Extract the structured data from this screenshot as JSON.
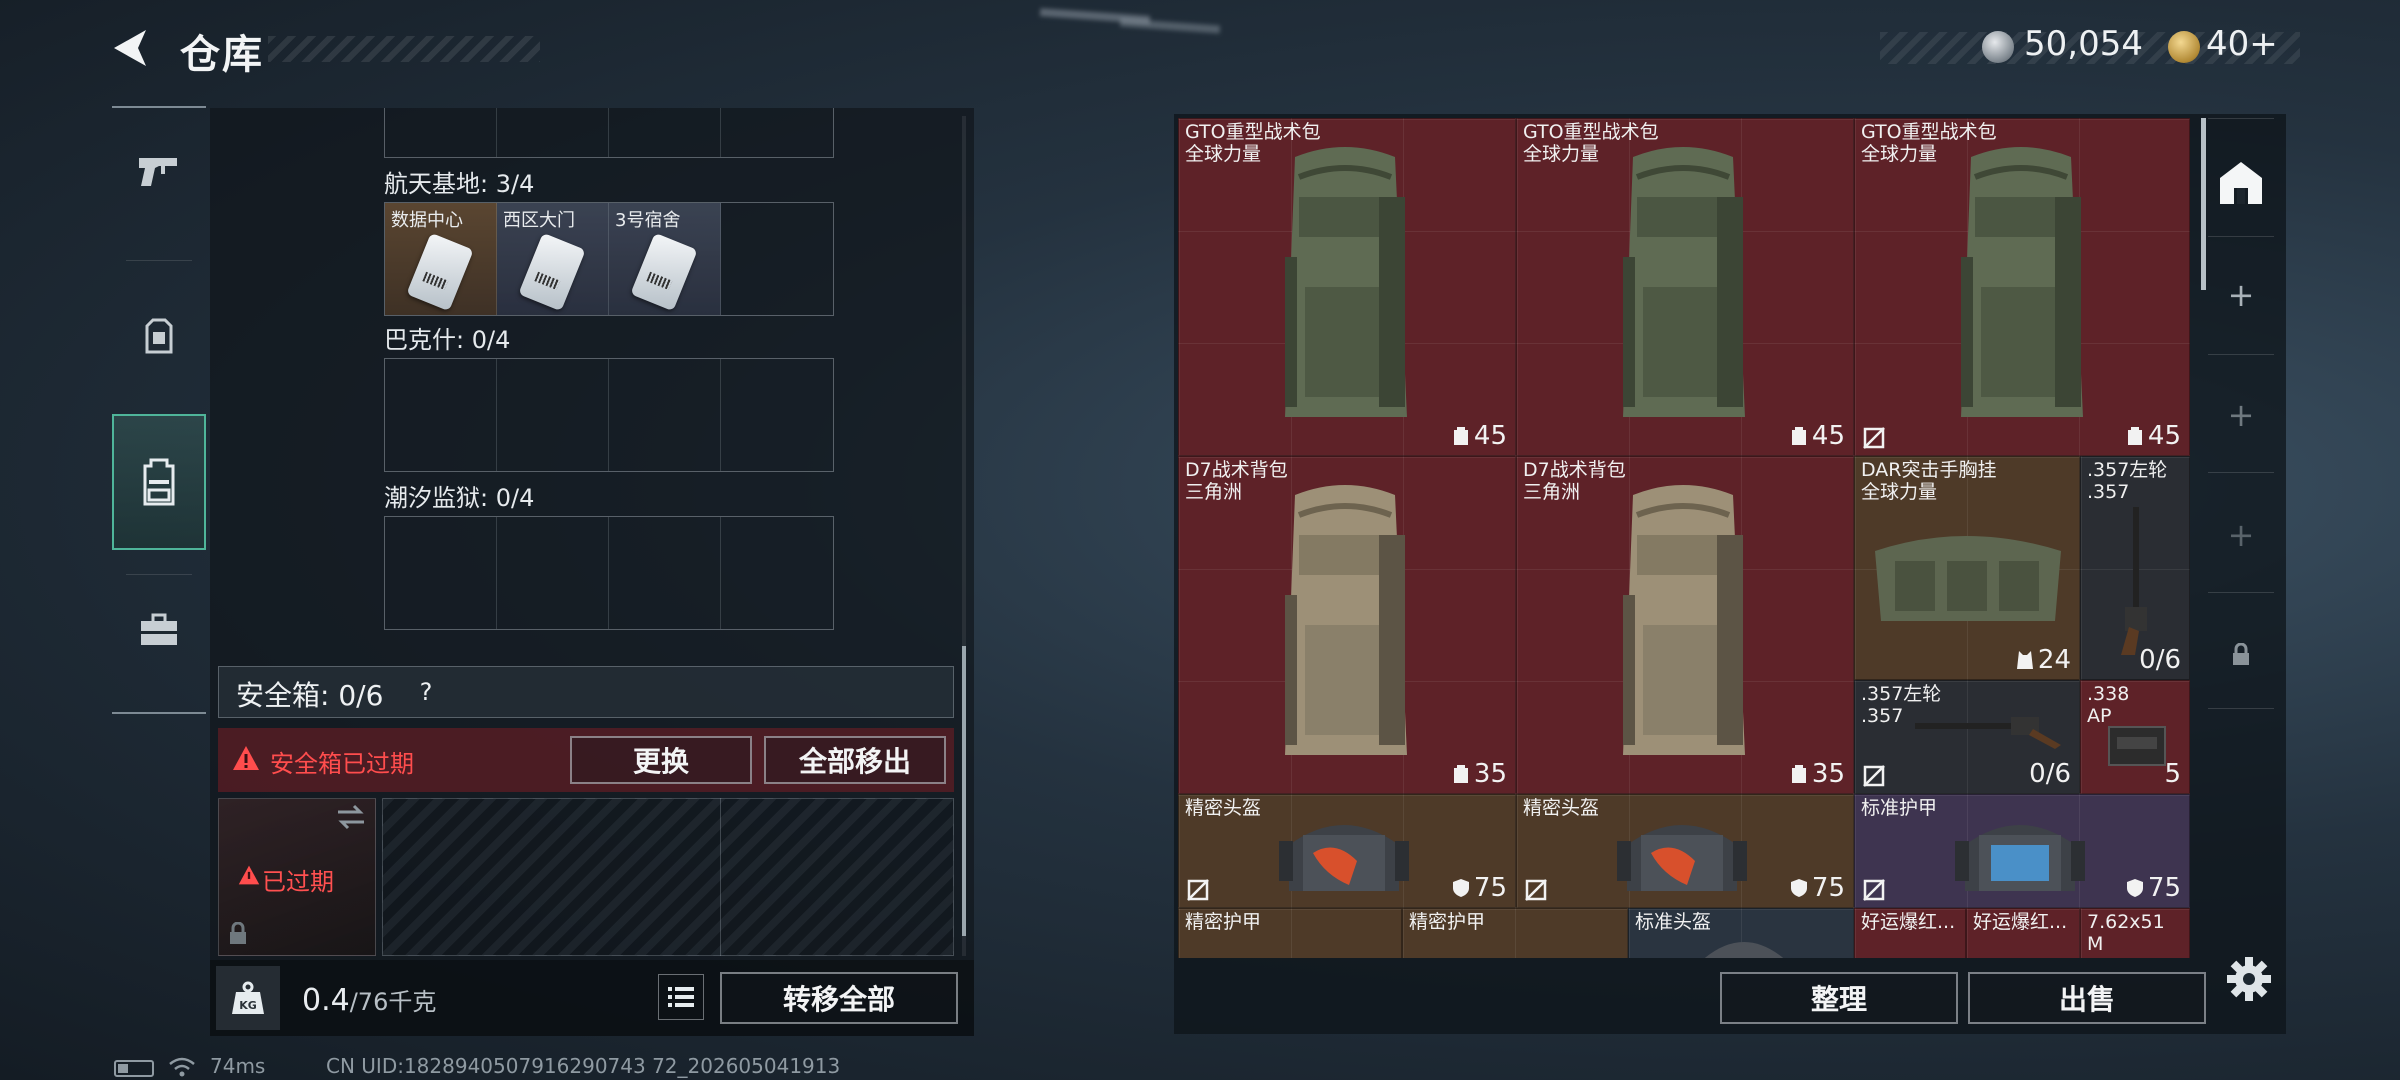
{
  "header": {
    "title": "仓库",
    "currency_silver": "50,054",
    "currency_gold": "40+"
  },
  "left_rail": {
    "items": [
      "weapon-tab",
      "armor-tab",
      "backpack-tab",
      "toolbox-tab"
    ],
    "active": "backpack-tab"
  },
  "key_sections": [
    {
      "label": "航天基地: 3/4",
      "keys": [
        "数据中心",
        "西区大门",
        "3号宿舍"
      ]
    },
    {
      "label": "巴克什: 0/4",
      "keys": []
    },
    {
      "label": "潮汐监狱: 0/4",
      "keys": []
    }
  ],
  "safe_box": {
    "title": "安全箱: 0/6",
    "help": "?",
    "expired_notice": "安全箱已过期",
    "replace_label": "更换",
    "remove_all_label": "全部移出",
    "slot_status": "已过期"
  },
  "footer_left": {
    "weight": "0.4",
    "weight_unit": "/76千克",
    "kg_label": "KG",
    "transfer_label": "转移全部"
  },
  "items": [
    {
      "name1": "GTO重型战术包",
      "name2": "全球力量",
      "count": "45",
      "icon": "backpack-icon"
    },
    {
      "name1": "GTO重型战术包",
      "name2": "全球力量",
      "count": "45",
      "icon": "backpack-icon"
    },
    {
      "name1": "GTO重型战术包",
      "name2": "全球力量",
      "count": "45",
      "icon": "backpack-icon"
    },
    {
      "name1": "D7战术背包",
      "name2": "三角洲",
      "count": "35",
      "icon": "backpack-icon"
    },
    {
      "name1": "D7战术背包",
      "name2": "三角洲",
      "count": "35",
      "icon": "backpack-icon"
    },
    {
      "name1": "DAR突击手胸挂",
      "name2": "全球力量",
      "count": "24",
      "icon": "vest-icon"
    },
    {
      "name1": ".357左轮",
      "name2": ".357",
      "count": "0/6",
      "icon": "ammo-icon"
    },
    {
      "name1": ".357左轮",
      "name2": ".357",
      "count": "0/6",
      "icon": "ammo-icon"
    },
    {
      "name1": ".338",
      "name2": "AP",
      "count": "5",
      "icon": ""
    },
    {
      "name1": "精密头盔",
      "name2": "",
      "count": "75",
      "icon": "shield-icon"
    },
    {
      "name1": "精密头盔",
      "name2": "",
      "count": "75",
      "icon": "shield-icon"
    },
    {
      "name1": "标准护甲",
      "name2": "",
      "count": "75",
      "icon": "shield-icon"
    },
    {
      "name1": "精密护甲",
      "name2": "",
      "count": "",
      "icon": ""
    },
    {
      "name1": "精密护甲",
      "name2": "",
      "count": "",
      "icon": ""
    },
    {
      "name1": "标准头盔",
      "name2": "",
      "count": "",
      "icon": ""
    },
    {
      "name1": "好运爆红...",
      "name2": "",
      "count": "",
      "icon": ""
    },
    {
      "name1": "好运爆红...",
      "name2": "",
      "count": "",
      "icon": ""
    },
    {
      "name1": "7.62x51",
      "name2": "M",
      "count": "",
      "icon": ""
    }
  ],
  "footer_right": {
    "sort_label": "整理",
    "sell_label": "出售"
  },
  "status": {
    "ping": "74ms",
    "uid": "CN UID:1828940507916290743 72_202605041913"
  }
}
